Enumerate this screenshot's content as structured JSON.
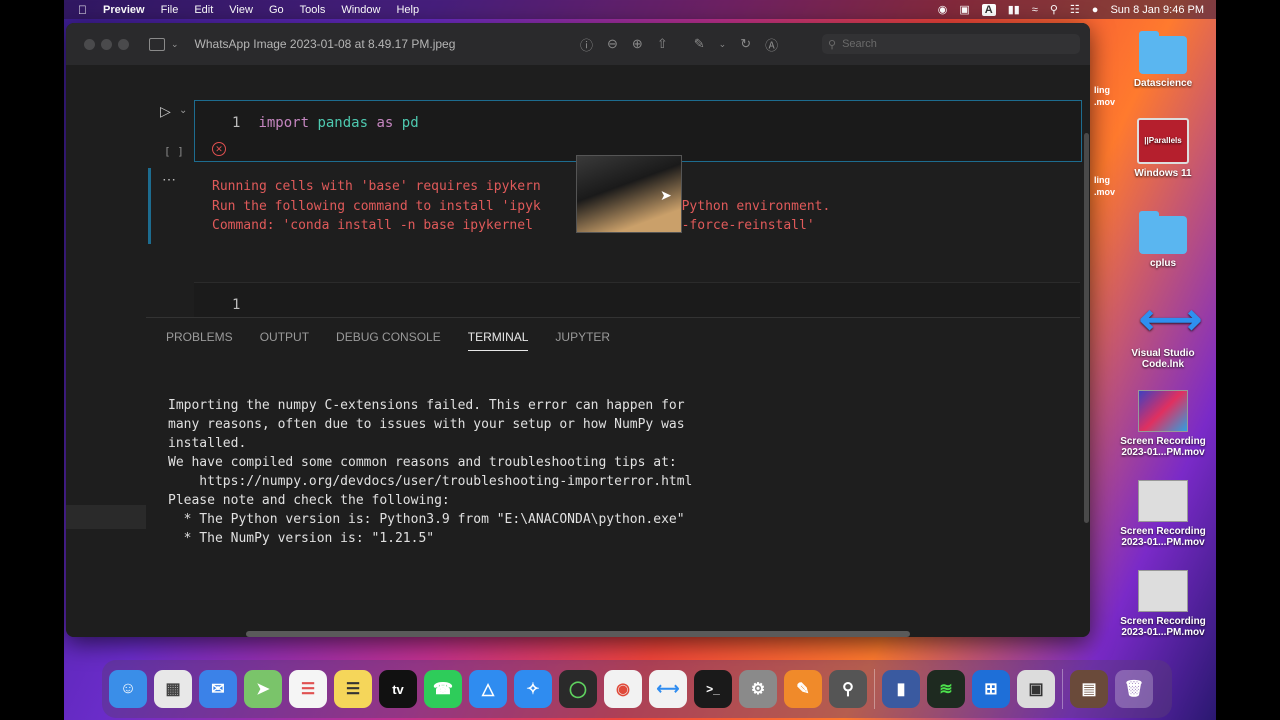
{
  "menubar": {
    "app": "Preview",
    "items": [
      "File",
      "Edit",
      "View",
      "Go",
      "Tools",
      "Window",
      "Help"
    ],
    "clock": "Sun 8 Jan  9:46 PM",
    "input_badge": "A"
  },
  "window": {
    "title": "WhatsApp Image 2023-01-08 at 8.49.17 PM.jpeg",
    "search_placeholder": "Search"
  },
  "notebook": {
    "cell1": {
      "line_number": "1",
      "kw_import": "import",
      "module": "pandas",
      "kw_as": "as",
      "alias": "pd",
      "exec_count": "[ ]"
    },
    "output_lines": [
      "Running cells with 'base' requires ipykern",
      "Run the following command to install 'ipyk              the Python environment.",
      "Command: 'conda install -n base ipykernel                s --force-reinstall'"
    ],
    "cell2_line_number": "1"
  },
  "panel": {
    "tabs": [
      "PROBLEMS",
      "OUTPUT",
      "DEBUG CONSOLE",
      "TERMINAL",
      "JUPYTER"
    ],
    "active_tab": "TERMINAL",
    "terminal_lines": [
      "Importing the numpy C-extensions failed. This error can happen for",
      "many reasons, often due to issues with your setup or how NumPy was",
      "installed.",
      "",
      "We have compiled some common reasons and troubleshooting tips at:",
      "",
      "    https://numpy.org/devdocs/user/troubleshooting-importerror.html",
      "",
      "Please note and check the following:",
      "",
      "  * The Python version is: Python3.9 from \"E:\\ANACONDA\\python.exe\"",
      "  * The NumPy version is: \"1.21.5\""
    ]
  },
  "desktop": {
    "icons": [
      {
        "label": "Datascience",
        "kind": "folder"
      },
      {
        "label": "Windows 11",
        "kind": "parallels",
        "badge": "||Parallels"
      },
      {
        "label": "cplus",
        "kind": "folder"
      },
      {
        "label": "Visual Studio Code.lnk",
        "kind": "vscode"
      },
      {
        "label": "Screen Recording 2023-01...PM.mov",
        "kind": "recording"
      },
      {
        "label": "Screen Recording 2023-01...PM.mov",
        "kind": "recording"
      },
      {
        "label": "Screen Recording 2023-01...PM.mov",
        "kind": "recording"
      }
    ],
    "partial_labels": [
      "ling",
      ".mov",
      "ling",
      ".mov"
    ]
  },
  "dock": {
    "apps": [
      "finder-icon",
      "launchpad-icon",
      "mail-icon",
      "maps-icon",
      "reminders-icon",
      "notes-icon",
      "apple-tv-icon",
      "whatsapp-icon",
      "app-store-icon",
      "safari-icon",
      "circle-app-icon",
      "chrome-icon",
      "vscode-icon",
      "terminal-icon",
      "system-settings-icon",
      "sublime-icon",
      "quicktime-icon",
      "parallels-icon",
      "activity-monitor-icon",
      "windows-icon",
      "preview-icon",
      "downloads-stack-icon",
      "trash-icon"
    ],
    "tv_label": "tv"
  }
}
